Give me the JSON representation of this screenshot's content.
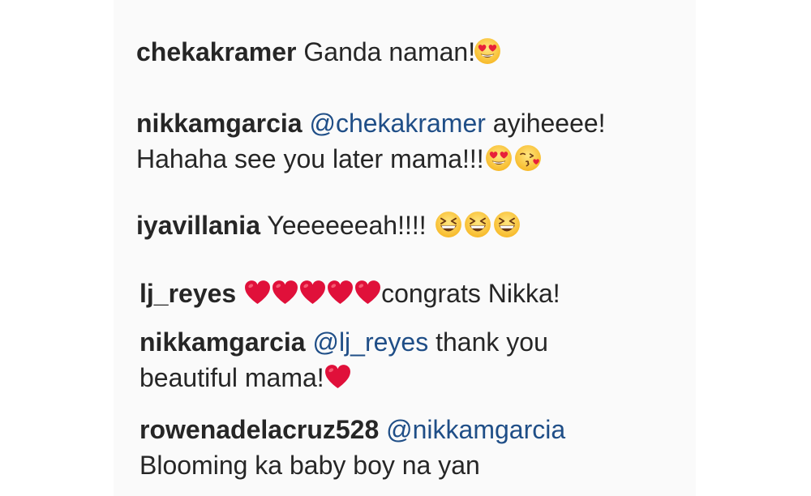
{
  "comments": [
    {
      "username": "chekakramer",
      "text": "Ganda naman!",
      "emojis": [
        "heart-eyes-icon"
      ]
    },
    {
      "username": "nikkamgarcia",
      "mention": "@chekakramer",
      "text_line1": "ayiheeee!",
      "text_line2": "Hahaha see you later mama!!!",
      "emojis": [
        "heart-eyes-icon",
        "kissing-heart-icon"
      ]
    },
    {
      "username": "iyavillania",
      "text": "Yeeeeeeah!!!!",
      "emojis": [
        "laughing-icon",
        "laughing-icon",
        "laughing-icon"
      ]
    },
    {
      "username": "lj_reyes",
      "text": "congrats Nikka!",
      "emojis": [
        "red-heart-icon",
        "red-heart-icon",
        "red-heart-icon",
        "red-heart-icon",
        "red-heart-icon"
      ]
    },
    {
      "username": "nikkamgarcia",
      "mention": "@lj_reyes",
      "text_line1": "thank you",
      "text_line2": "beautiful mama!",
      "emojis": [
        "red-heart-icon"
      ]
    },
    {
      "username": "rowenadelacruz528",
      "mention": "@nikkamgarcia",
      "text_line2": "Blooming ka baby boy na yan"
    }
  ],
  "colors": {
    "background": "#fafafa",
    "text": "#262626",
    "mention": "#1f4e87",
    "heart": "#e0103a"
  }
}
